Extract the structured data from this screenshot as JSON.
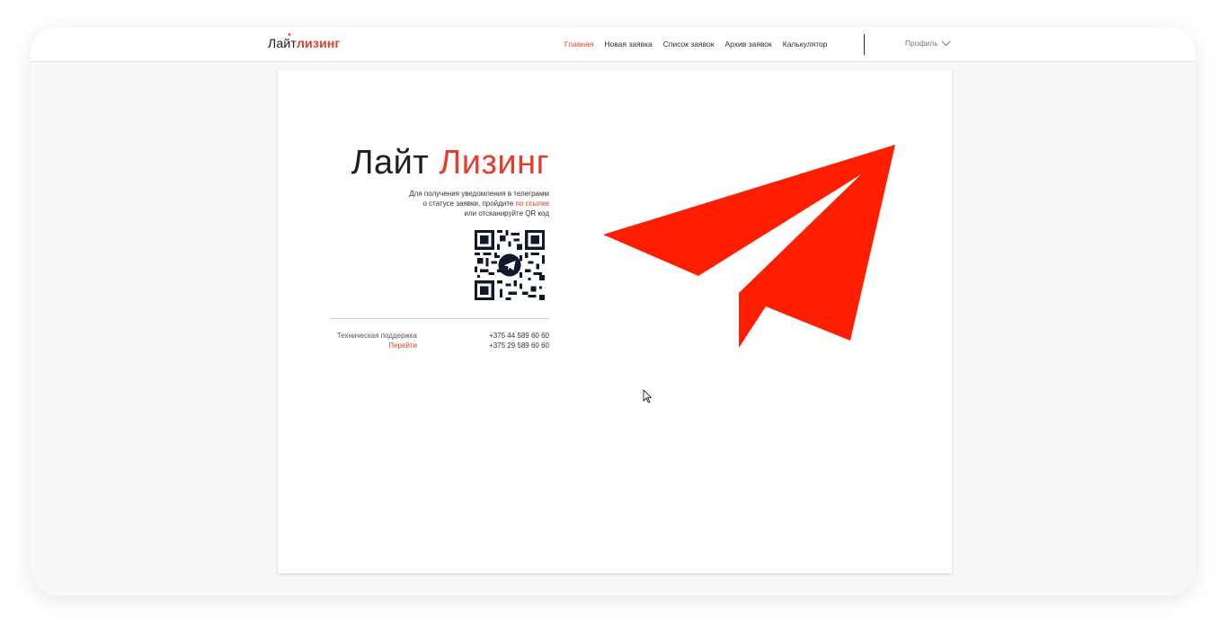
{
  "logo": {
    "part1": "Лайт",
    "part2": "лизинг"
  },
  "nav": {
    "items": [
      {
        "label": "Главная",
        "active": true
      },
      {
        "label": "Новая заявка",
        "active": false
      },
      {
        "label": "Список заявок",
        "active": false
      },
      {
        "label": "Архив заявок",
        "active": false
      },
      {
        "label": "Калькулятор",
        "active": false
      }
    ],
    "profile": "Профиль",
    "profile_icon": "chevron-down-icon"
  },
  "main": {
    "title_part1": "Лайт",
    "title_part2": "Лизинг",
    "info_line1": "Для получения уведомления в телеграмм",
    "info_line2_pre": "о статусе заявки, пройдите",
    "info_link": "по ссылке",
    "info_line3": "или отсканируйте QR код",
    "qr_icon": "telegram-qr-code",
    "support_label": "Техническая поддержка",
    "support_link": "Перейти",
    "phone1": "+375 44 589 60 60",
    "phone2": "+375 29 589 60 60",
    "illustration": "paper-plane-icon"
  },
  "colors": {
    "accent": "#e53d2a",
    "plane": "#ff1e00",
    "text": "#1f1f1f",
    "background": "#f7f7f7"
  }
}
